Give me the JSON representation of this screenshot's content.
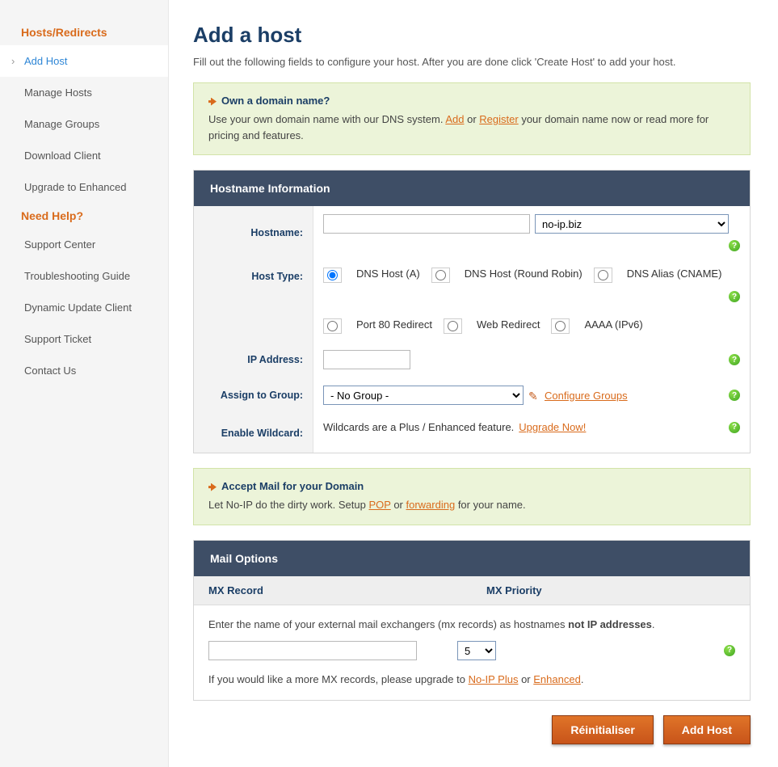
{
  "sidebar": {
    "section1_title": "Hosts/Redirects",
    "items1": [
      {
        "label": "Add Host",
        "active": true
      },
      {
        "label": "Manage Hosts"
      },
      {
        "label": "Manage Groups"
      },
      {
        "label": "Download Client"
      },
      {
        "label": "Upgrade to Enhanced"
      }
    ],
    "section2_title": "Need Help?",
    "items2": [
      {
        "label": "Support Center"
      },
      {
        "label": "Troubleshooting Guide"
      },
      {
        "label": "Dynamic Update Client"
      },
      {
        "label": "Support Ticket"
      },
      {
        "label": "Contact Us"
      }
    ]
  },
  "main": {
    "title": "Add a host",
    "subtitle": "Fill out the following fields to configure your host. After you are done click 'Create Host' to add your host."
  },
  "notice_domain": {
    "title": "Own a domain name?",
    "body_prefix": "Use your own domain name with our DNS system. ",
    "add": "Add",
    "or": " or ",
    "register": "Register",
    "body_suffix": " your domain name now or read more for pricing and features."
  },
  "hostname_panel": {
    "header": "Hostname Information",
    "rows": {
      "hostname_label": "Hostname:",
      "hostname_value": "",
      "hostname_domain_selected": "no-ip.biz",
      "hosttype_label": "Host Type:",
      "hosttype_options": [
        "DNS Host (A)",
        "DNS Host (Round Robin)",
        "DNS Alias (CNAME)",
        "Port 80 Redirect",
        "Web Redirect",
        "AAAA (IPv6)"
      ],
      "hosttype_selected": "DNS Host (A)",
      "ip_label": "IP Address:",
      "ip_value": "",
      "group_label": "Assign to Group:",
      "group_selected": "- No Group -",
      "configure_groups": "Configure Groups",
      "wildcard_label": "Enable Wildcard:",
      "wildcard_text": "Wildcards are a Plus / Enhanced feature. ",
      "wildcard_link": "Upgrade Now!"
    }
  },
  "notice_mail": {
    "title": "Accept Mail for your Domain",
    "body_prefix": "Let No-IP do the dirty work. Setup ",
    "pop": "POP",
    "or": " or ",
    "forwarding": "forwarding",
    "body_suffix": " for your name."
  },
  "mail_panel": {
    "header": "Mail Options",
    "mx_record_header": "MX Record",
    "mx_priority_header": "MX Priority",
    "instruction_prefix": "Enter the name of your external mail exchangers (mx records) as hostnames ",
    "instruction_bold": "not IP addresses",
    "instruction_suffix": ".",
    "mx_record_value": "",
    "mx_priority_value": "5",
    "upgrade_prefix": "If you would like a more MX records, please upgrade to ",
    "noip_plus": "No-IP Plus",
    "or": " or ",
    "enhanced": "Enhanced",
    "upgrade_suffix": "."
  },
  "buttons": {
    "reset": "Réinitialiser",
    "add_host": "Add Host"
  },
  "help_glyph": "?"
}
